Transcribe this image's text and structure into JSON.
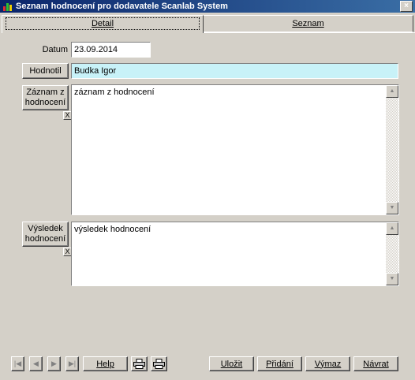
{
  "window": {
    "title": "Seznam hodnocení pro dodavatele Scanlab System",
    "close_label": "×"
  },
  "tabs": [
    {
      "label": "Detail"
    },
    {
      "label": "Seznam"
    }
  ],
  "form": {
    "datum_label": "Datum",
    "datum_value": "23.09.2014",
    "hodnotil_button": "Hodnotil",
    "hodnotil_value": "Budka Igor",
    "zaznam_button_line1": "Záznam z",
    "zaznam_button_line2": "hodnocení",
    "zaznam_value": "záznam z hodnocení",
    "clear_label": "X",
    "vysledek_button_line1": "Výsledek",
    "vysledek_button_line2": "hodnocení",
    "vysledek_value": "výsledek hodnocení"
  },
  "toolbar": {
    "first": "|◀",
    "prev": "◀",
    "next": "▶",
    "last": "▶|",
    "help": "Help",
    "print_icon": "printer-icon",
    "print_preview_icon": "printer-icon",
    "save": "Uložit",
    "add": "Přidání",
    "delete": "Výmaz",
    "back": "Návrat"
  }
}
